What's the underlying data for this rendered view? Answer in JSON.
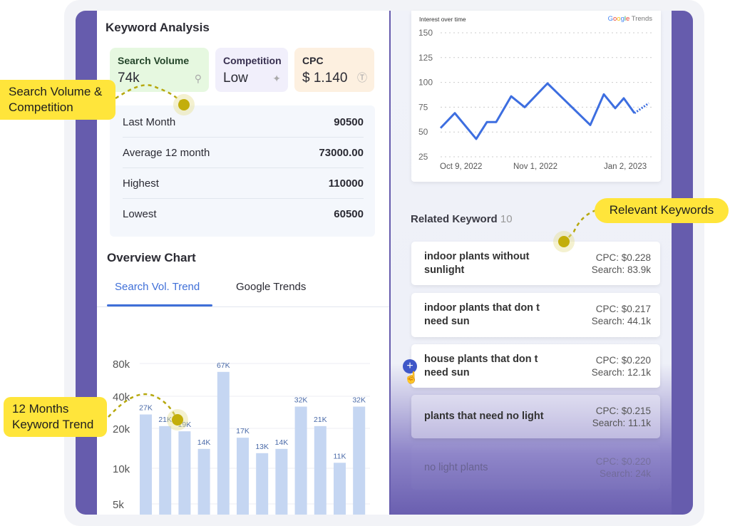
{
  "keyword_analysis": {
    "title": "Keyword Analysis",
    "cards": [
      {
        "label": "Search Volume",
        "value": "74k",
        "icon": "search-icon",
        "color": "#e6f8e0"
      },
      {
        "label": "Competition",
        "value": "Low",
        "icon": "muscle-icon",
        "color": "#f1effb"
      },
      {
        "label": "CPC",
        "value": "$ 1.140",
        "icon": "dollar-coin-icon",
        "color": "#fdf0e0"
      }
    ],
    "stats": [
      {
        "label": "Last Month",
        "value": "90500"
      },
      {
        "label": "Average 12 month",
        "value": "73000.00"
      },
      {
        "label": "Highest",
        "value": "110000"
      },
      {
        "label": "Lowest",
        "value": "60500"
      }
    ]
  },
  "overview": {
    "title": "Overview Chart",
    "tabs": [
      {
        "label": "Search Vol. Trend",
        "active": true
      },
      {
        "label": "Google Trends",
        "active": false
      }
    ],
    "accent": "#3f6fd8"
  },
  "callouts": {
    "search_volume": "Search Volume &\nCompetition",
    "relevant": "Relevant Keywords",
    "trend": "12 Months\nKeyword Trend"
  },
  "related": {
    "title": "Related Keyword",
    "count": "10",
    "items": [
      {
        "keyword": "indoor plants without sunlight",
        "cpc": "CPC: $0.228",
        "search": "Search: 83.9k"
      },
      {
        "keyword": "indoor plants that don t need sun",
        "cpc": "CPC: $0.217",
        "search": "Search: 44.1k"
      },
      {
        "keyword": "house plants that don t need sun",
        "cpc": "CPC: $0.220",
        "search": "Search: 12.1k"
      },
      {
        "keyword": "plants that need no light",
        "cpc": "CPC: $0.215",
        "search": "Search: 11.1k"
      },
      {
        "keyword": "no light plants",
        "cpc": "CPC: $0.220",
        "search": "Search: 24k"
      }
    ]
  },
  "chart_data": [
    {
      "type": "bar",
      "title": "",
      "yscale": "log",
      "yticks": [
        "80k",
        "40k",
        "20k",
        "10k",
        "5k"
      ],
      "ytick_values": [
        80000,
        40000,
        20000,
        10000,
        5000
      ],
      "values": [
        27000,
        21000,
        19000,
        14000,
        67000,
        17000,
        13000,
        14000,
        32000,
        21000,
        11000,
        32000
      ],
      "labels": [
        "27K",
        "21K",
        "19K",
        "14K",
        "67K",
        "17K",
        "13K",
        "14K",
        "32K",
        "21K",
        "11K",
        "32K"
      ],
      "color": "#c5d6f2",
      "grid": true
    },
    {
      "type": "line",
      "title": "Interest over time",
      "brand": "Google Trends",
      "ylim": [
        25,
        150
      ],
      "yticks": [
        "150",
        "125",
        "100",
        "75",
        "50",
        "25"
      ],
      "xticks": [
        "Oct 9, 2022",
        "Nov 1, 2022",
        "Jan 2, 2023"
      ],
      "values": [
        54,
        69,
        43,
        60,
        60,
        86,
        75,
        99,
        57,
        88,
        74,
        84,
        69,
        79
      ],
      "partial_last": true,
      "color": "#3d6ee0",
      "grid": "dotted"
    }
  ]
}
